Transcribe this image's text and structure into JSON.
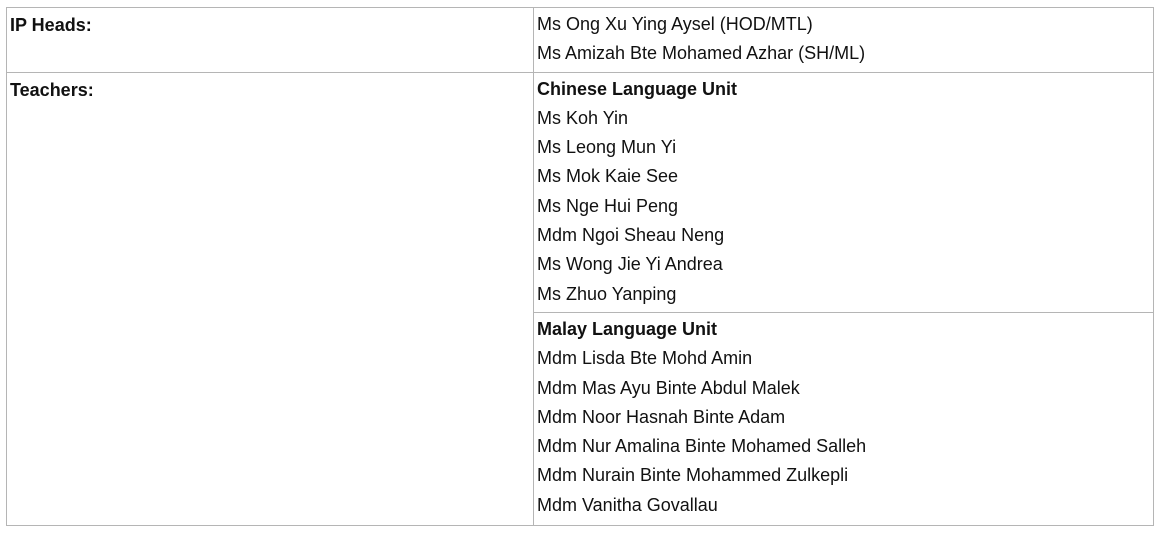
{
  "table": {
    "ip_heads": {
      "label": "IP Heads:",
      "names": [
        "Ms Ong Xu Ying Aysel (HOD/MTL)",
        "Ms Amizah Bte Mohamed Azhar (SH/ML)"
      ]
    },
    "teachers": {
      "label": "Teachers:",
      "units": [
        {
          "title": "Chinese Language Unit",
          "names": [
            "Ms Koh Yin",
            "Ms Leong Mun Yi",
            "Ms Mok Kaie See",
            "Ms Nge Hui Peng",
            "Mdm Ngoi Sheau Neng",
            "Ms Wong Jie Yi Andrea",
            "Ms Zhuo Yanping"
          ]
        },
        {
          "title": "Malay Language Unit",
          "names": [
            "Mdm Lisda Bte Mohd Amin",
            "Mdm Mas Ayu Binte Abdul Malek",
            "Mdm Noor Hasnah Binte Adam",
            "Mdm Nur Amalina Binte Mohamed Salleh",
            "Mdm Nurain Binte Mohammed Zulkepli",
            "Mdm Vanitha Govallau"
          ]
        }
      ]
    }
  }
}
